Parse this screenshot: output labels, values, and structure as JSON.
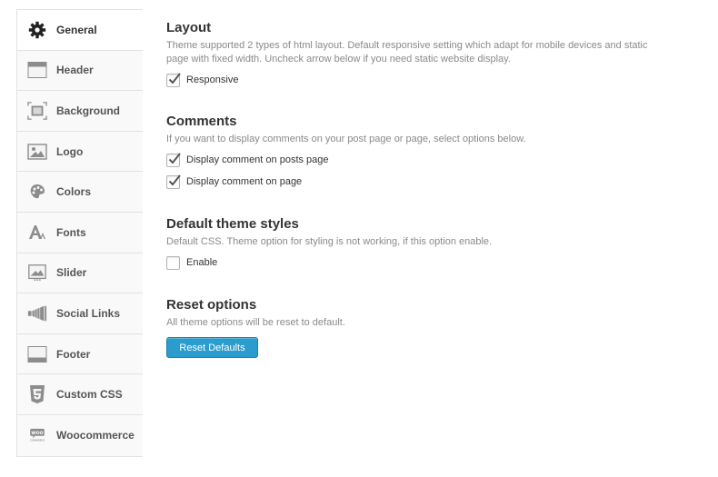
{
  "sidebar": {
    "items": [
      {
        "label": "General",
        "icon": "gear-icon",
        "active": true
      },
      {
        "label": "Header",
        "icon": "header-icon",
        "active": false
      },
      {
        "label": "Background",
        "icon": "background-icon",
        "active": false
      },
      {
        "label": "Logo",
        "icon": "image-icon",
        "active": false
      },
      {
        "label": "Colors",
        "icon": "palette-icon",
        "active": false
      },
      {
        "label": "Fonts",
        "icon": "font-icon",
        "active": false
      },
      {
        "label": "Slider",
        "icon": "slider-icon",
        "active": false
      },
      {
        "label": "Social Links",
        "icon": "megaphone-icon",
        "active": false
      },
      {
        "label": "Footer",
        "icon": "footer-icon",
        "active": false
      },
      {
        "label": "Custom CSS",
        "icon": "css3-icon",
        "active": false
      },
      {
        "label": "Woocommerce",
        "icon": "woocommerce-icon",
        "active": false
      }
    ],
    "woo_icon_text_top": "WOO",
    "woo_icon_text_bottom": "COMMERCE"
  },
  "sections": {
    "layout": {
      "title": "Layout",
      "desc_line1": "Theme supported 2 types of html layout. Default responsive setting which adapt for mobile devices and static",
      "desc_line2": "page with fixed width. Uncheck arrow below if you need static website display.",
      "options": [
        {
          "label": "Responsive",
          "checked": true
        }
      ]
    },
    "comments": {
      "title": "Comments",
      "desc": "If you want to display comments on your post page or page, select options below.",
      "options": [
        {
          "label": "Display comment on posts page",
          "checked": true
        },
        {
          "label": "Display comment on page",
          "checked": true
        }
      ]
    },
    "default_styles": {
      "title": "Default theme styles",
      "desc": "Default CSS. Theme option for styling is not working, if this option enable.",
      "options": [
        {
          "label": "Enable",
          "checked": false
        }
      ]
    },
    "reset": {
      "title": "Reset options",
      "desc": "All theme options will be reset to default.",
      "button_label": "Reset Defaults"
    }
  },
  "colors": {
    "accent": "#2a9ccd",
    "sidebar_bg": "#f9f9f9",
    "desc_text": "#8a8a8a"
  }
}
